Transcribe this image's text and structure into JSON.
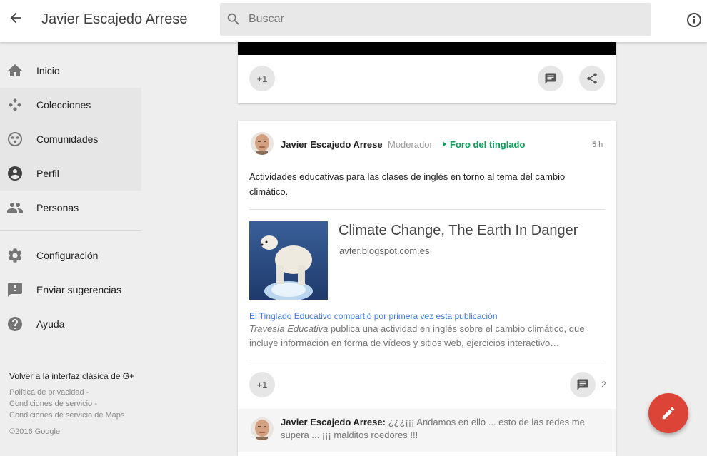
{
  "header": {
    "title": "Javier Escajedo Arrese",
    "search_placeholder": "Buscar"
  },
  "sidebar": {
    "items": [
      {
        "label": "Inicio",
        "icon": "home-icon"
      },
      {
        "label": "Colecciones",
        "icon": "collections-icon"
      },
      {
        "label": "Comunidades",
        "icon": "communities-icon"
      },
      {
        "label": "Perfil",
        "icon": "profile-icon"
      },
      {
        "label": "Personas",
        "icon": "people-icon"
      },
      {
        "label": "Configuración",
        "icon": "gear-icon"
      },
      {
        "label": "Enviar sugerencias",
        "icon": "feedback-icon"
      },
      {
        "label": "Ayuda",
        "icon": "help-icon"
      }
    ],
    "classic_link": "Volver a la interfaz clásica de G+",
    "footer_links": [
      "Política de privacidad -",
      "Condiciones de servicio -",
      "Condiciones de servicio de Maps",
      "©2016 Google"
    ]
  },
  "top_card": {
    "plus_one": "+1"
  },
  "post": {
    "author": "Javier Escajedo Arrese",
    "role": "Moderador",
    "community": "Foro del tinglado",
    "time": "5 h",
    "text": "Actividades educativas para las clases de inglés en torno al tema del cambio climático.",
    "link": {
      "title": "Climate Change, The Earth In Danger",
      "domain": "avfer.blogspot.com.es"
    },
    "shared_by": "El Tinglado Educativo compartió por primera vez esta publicación",
    "snippet_italic": "Travesía Educativa",
    "snippet_rest": " publica una actividad en inglés sobre el cambio climático, que incluye información en forma de vídeos y sitios web, ejercicios interactivo…",
    "plus_one": "+1",
    "comment_count": "2"
  },
  "comment": {
    "author": "Javier Escajedo Arrese:",
    "text": " ¿¿¿¡¡¡ Andamos en ello ... esto de las redes me supera ... ¡¡¡ malditos roedores !!!"
  },
  "colors": {
    "accent_green": "#0f9d58",
    "fab_red": "#db4437",
    "link_blue": "#3b78e7"
  }
}
